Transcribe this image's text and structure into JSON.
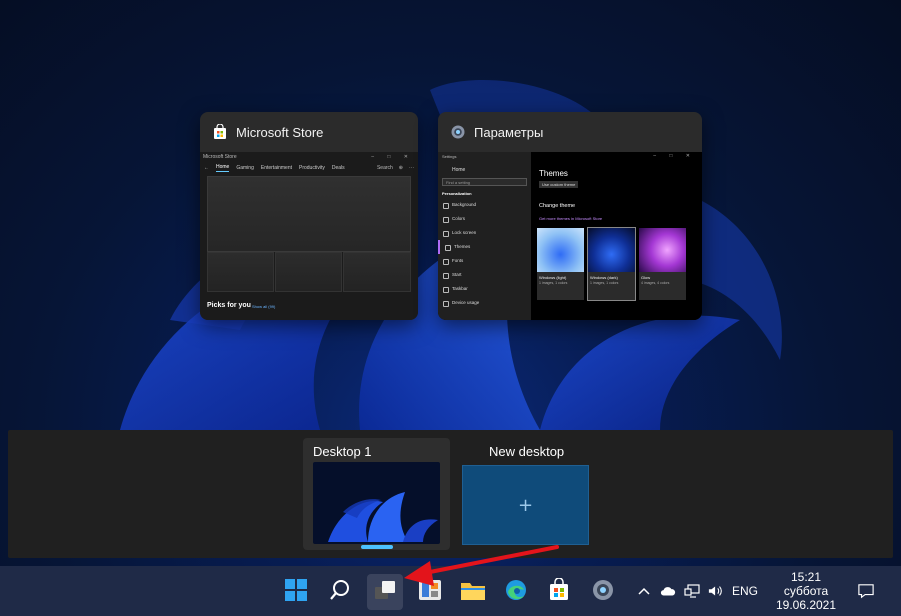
{
  "windows": [
    {
      "title": "Microsoft Store",
      "icon": "store-bag-icon"
    },
    {
      "title": "Параметры",
      "icon": "settings-gear-icon"
    }
  ],
  "store_thumb": {
    "caption": "Microsoft Store",
    "nav": [
      "Home",
      "Gaming",
      "Entertainment",
      "Productivity",
      "Deals"
    ],
    "search": "Search",
    "picks_title": "Picks for you",
    "show_all": "Show all (99)"
  },
  "settings_thumb": {
    "caption": "Settings",
    "home": "Home",
    "find_placeholder": "Find a setting",
    "group": "Personalization",
    "nav": [
      "Background",
      "Colors",
      "Lock screen",
      "Themes",
      "Fonts",
      "Start",
      "Taskbar",
      "Device usage"
    ],
    "heading": "Themes",
    "custom_button": "Use custom theme",
    "change_theme": "Change theme",
    "store_link": "Get more themes in Microsoft Store",
    "themes": [
      {
        "name": "Windows (light)",
        "sub": "1 images, 1 colors"
      },
      {
        "name": "Windows (dark)",
        "sub": "1 images, 1 colors"
      },
      {
        "name": "Glow",
        "sub": "4 images, 4 colors"
      }
    ]
  },
  "desktops": {
    "current": "Desktop 1",
    "new": "New desktop",
    "new_symbol": "+"
  },
  "taskbar": {
    "apps": [
      "start-icon",
      "search-icon",
      "task-view-icon",
      "widgets-icon",
      "file-explorer-icon",
      "edge-icon",
      "store-icon",
      "settings-icon"
    ],
    "language": "ENG",
    "time": "15:21",
    "day": "суббота",
    "date": "19.06.2021"
  },
  "colors": {
    "accent": "#4cc2ff",
    "annotation": "#e3141b",
    "taskbar": "#1f2a47"
  }
}
